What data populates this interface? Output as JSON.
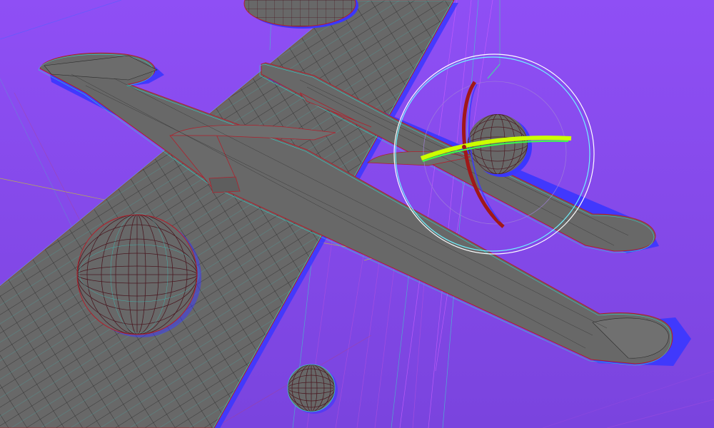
{
  "viewport": {
    "background_top": "#8f4ff5",
    "background_bottom": "#7a44de",
    "mesh_fill": "#686868",
    "mesh_fill_light": "#707070",
    "wire_cyan": "#34d0c8",
    "wire_red": "#b0202c",
    "wire_magenta": "#e040f0",
    "ghost_blue": "#3a37ff",
    "gizmo_ring_outer": "#ffffff",
    "gizmo_ring_inner": "#6ff3ff",
    "gizmo_ring_grey": "#a080d8",
    "gizmo_axis_yellow": "#ccff00",
    "gizmo_axis_green": "#3aff4a",
    "gizmo_axis_red": "#a01818",
    "guide_yellow": "#c8d020"
  },
  "objects": [
    {
      "name": "ground-plank",
      "type": "subdivided-plane"
    },
    {
      "name": "airplane-model",
      "type": "mesh"
    },
    {
      "name": "sphere-large",
      "type": "uv-sphere"
    },
    {
      "name": "sphere-top",
      "type": "uv-sphere"
    },
    {
      "name": "sphere-selected",
      "type": "uv-sphere",
      "selected": true
    },
    {
      "name": "sphere-small",
      "type": "uv-sphere"
    }
  ],
  "gizmo": {
    "mode": "rotate",
    "icon": "rotate-gizmo-icon"
  }
}
